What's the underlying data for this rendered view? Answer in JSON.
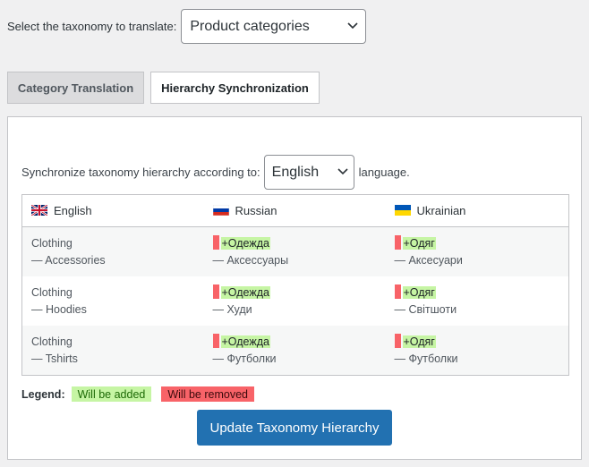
{
  "taxonomy": {
    "label": "Select the taxonomy to translate:",
    "selected": "Product categories"
  },
  "tabs": [
    {
      "label": "Category Translation",
      "active": false
    },
    {
      "label": "Hierarchy Synchronization",
      "active": true
    }
  ],
  "sync": {
    "prefix": "Synchronize taxonomy hierarchy according to:",
    "selected_language": "English",
    "suffix": "language."
  },
  "table": {
    "columns": [
      {
        "label": "English",
        "flag": "uk-flag-icon"
      },
      {
        "label": "Russian",
        "flag": "russia-flag-icon"
      },
      {
        "label": "Ukrainian",
        "flag": "ukraine-flag-icon"
      }
    ],
    "rows": [
      {
        "english": {
          "parent": "Clothing",
          "child": "— Accessories"
        },
        "russian": {
          "added_parent": "+Одежда",
          "child": "— Аксессуары"
        },
        "ukrainian": {
          "added_parent": "+Одяг",
          "child": "— Аксесуари"
        }
      },
      {
        "english": {
          "parent": "Clothing",
          "child": "— Hoodies"
        },
        "russian": {
          "added_parent": "+Одежда",
          "child": "— Худи"
        },
        "ukrainian": {
          "added_parent": "+Одяг",
          "child": "— Світшоти"
        }
      },
      {
        "english": {
          "parent": "Clothing",
          "child": "— Tshirts"
        },
        "russian": {
          "added_parent": "+Одежда",
          "child": "— Футболки"
        },
        "ukrainian": {
          "added_parent": "+Одяг",
          "child": "— Футболки"
        }
      }
    ]
  },
  "legend": {
    "label": "Legend:",
    "added": "Will be added",
    "removed": "Will be removed"
  },
  "colors": {
    "added": "#c6f5a4",
    "removed": "#f86368",
    "primary_button": "#2271b1"
  },
  "button": {
    "label": "Update Taxonomy Hierarchy"
  }
}
